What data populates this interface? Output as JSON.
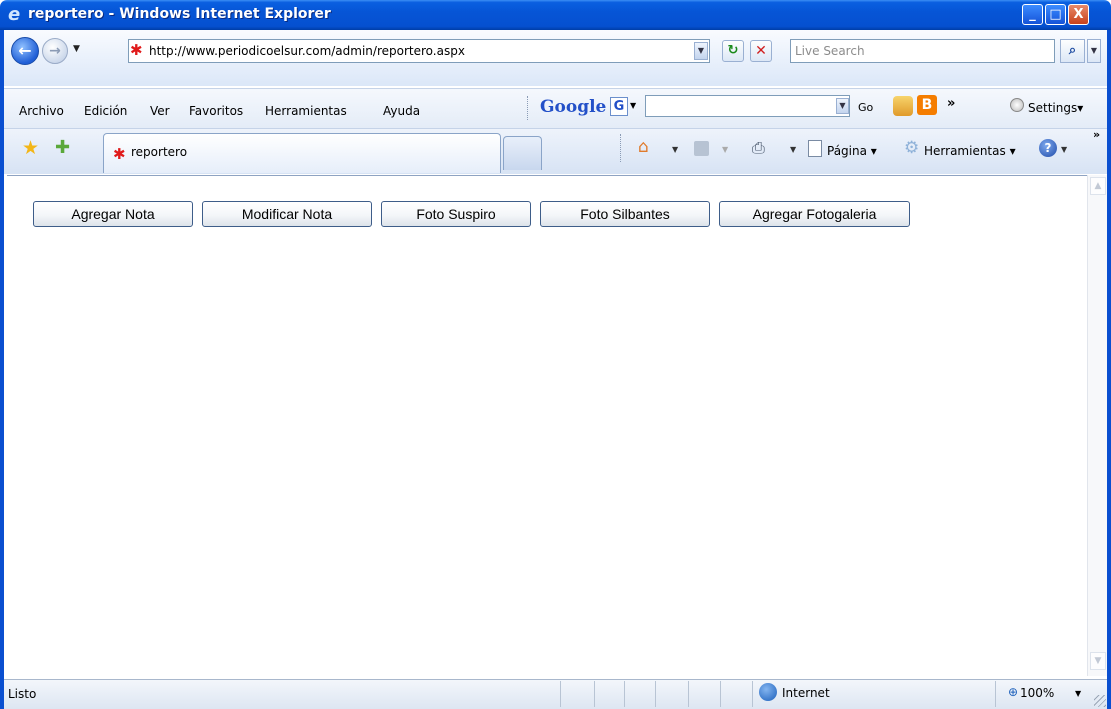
{
  "window": {
    "title": "reportero - Windows Internet Explorer",
    "controls": {
      "minimize": "_",
      "maximize": "□",
      "close": "X"
    }
  },
  "address_bar": {
    "url": "http://www.periodicoelsur.com/admin/reportero.aspx",
    "search_placeholder": "Live Search"
  },
  "menu": {
    "items": [
      "Archivo",
      "Edición",
      "Ver",
      "Favoritos",
      "Herramientas",
      "Ayuda"
    ]
  },
  "google_toolbar": {
    "logo": "Google",
    "go_label": "Go",
    "settings_label": "Settings▾",
    "blogger_glyph": "B",
    "more_glyph": "»"
  },
  "tabs": {
    "active_label": "reportero"
  },
  "command_bar": {
    "page_label": "Página",
    "tools_label": "Herramientas",
    "help_glyph": "?"
  },
  "page": {
    "buttons": [
      "Agregar Nota",
      "Modificar Nota",
      "Foto Suspiro",
      "Foto Silbantes",
      "Agregar Fotogaleria"
    ]
  },
  "status_bar": {
    "status": "Listo",
    "zone": "Internet",
    "zoom": "100%"
  },
  "icons": {
    "browser": "ie-logo-icon",
    "site": "site-favicon-icon",
    "back": "back-arrow-icon",
    "forward": "forward-arrow-icon",
    "refresh": "refresh-icon",
    "stop": "stop-icon",
    "search": "search-icon",
    "favorites": "favorites-star-icon",
    "add_favorites": "add-favorites-icon",
    "home": "home-icon",
    "feeds": "feeds-icon",
    "print": "print-icon",
    "page": "page-icon",
    "tools": "tools-gear-icon",
    "help": "help-icon",
    "zone": "internet-globe-icon"
  },
  "colors": {
    "titlebar": "#0655d6",
    "button_border": "#3e5d89",
    "close_button": "#c8411c"
  }
}
